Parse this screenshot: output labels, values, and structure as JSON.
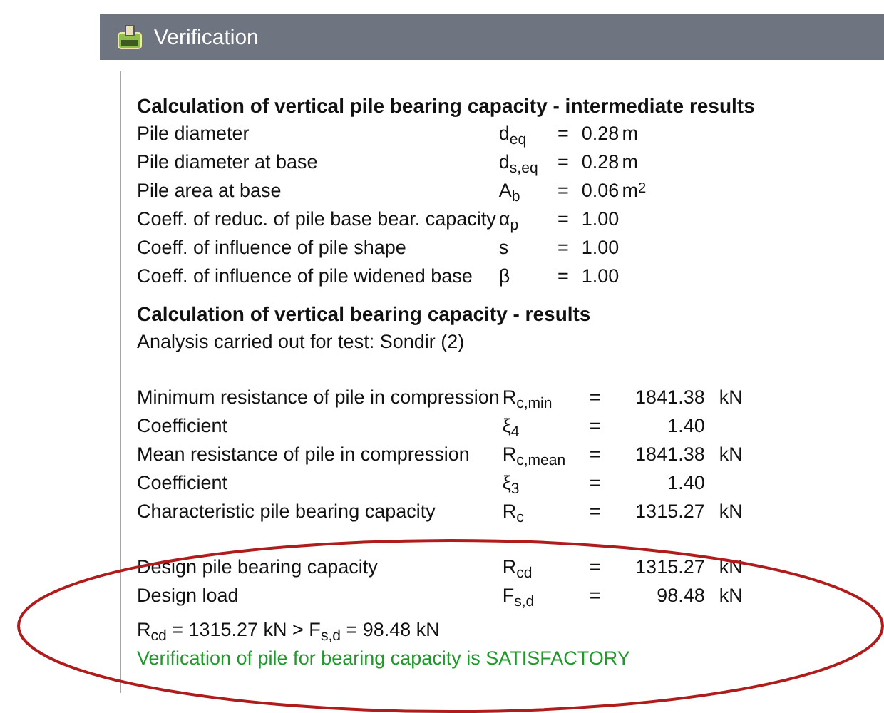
{
  "window": {
    "title": "Verification"
  },
  "intermediate": {
    "heading": "Calculation of vertical pile bearing capacity - intermediate results",
    "rows": [
      {
        "label": "Pile diameter",
        "symbol": "d$_{eq}$",
        "relation": "=",
        "value": "0.28",
        "unit": "m"
      },
      {
        "label": "Pile diameter at base",
        "symbol": "d$_{s,eq}$",
        "relation": "=",
        "value": "0.28",
        "unit": "m"
      },
      {
        "label": "Pile area at base",
        "symbol": "A$_{b}$",
        "relation": "=",
        "value": "0.06",
        "unit": "m$^{2}$"
      },
      {
        "label": "Coeff. of reduc. of pile base bear. capacity",
        "symbol": "α$_{p}$",
        "relation": "=",
        "value": "1.00"
      },
      {
        "label": "Coeff. of influence of pile shape",
        "symbol": "s",
        "relation": "=",
        "value": "1.00"
      },
      {
        "label": "Coeff. of influence of pile widened base",
        "symbol": "β",
        "relation": "=",
        "value": "1.00"
      }
    ]
  },
  "results": {
    "heading": "Calculation of vertical bearing capacity - results",
    "note": "Analysis carried out for test: Sondir (2)",
    "blocks": [
      [
        {
          "label": "Minimum resistance of pile in compression",
          "symbol": "R$_{c,min}$",
          "relation": "=",
          "value": "1841.38",
          "unit": "kN"
        },
        {
          "label": "Coefficient",
          "symbol": "ξ$_{4}$",
          "relation": "=",
          "value": "1.40"
        },
        {
          "label": "Mean resistance of pile in compression",
          "symbol": "R$_{c,mean}$",
          "relation": "=",
          "value": "1841.38",
          "unit": "kN"
        },
        {
          "label": "Coefficient",
          "symbol": "ξ$_{3}$",
          "relation": "=",
          "value": "1.40"
        },
        {
          "label": "Characteristic pile bearing capacity",
          "symbol": "R$_{c}$",
          "relation": "=",
          "value": "1315.27",
          "unit": "kN"
        }
      ],
      [
        {
          "label": "Design pile bearing capacity",
          "symbol": "R$_{cd}$",
          "relation": "=",
          "value": "1315.27",
          "unit": "kN"
        },
        {
          "label": "Design load",
          "symbol": "F$_{s,d}$",
          "relation": "=",
          "value": "98.48",
          "unit": "kN"
        }
      ]
    ],
    "equation": "R$_{cd}$ = 1315.27 kN > F$_{s,d}$ = 98.48 kN",
    "verdict": {
      "text": "Verification of pile for bearing capacity is SATISFACTORY",
      "satisfactory": true
    }
  }
}
